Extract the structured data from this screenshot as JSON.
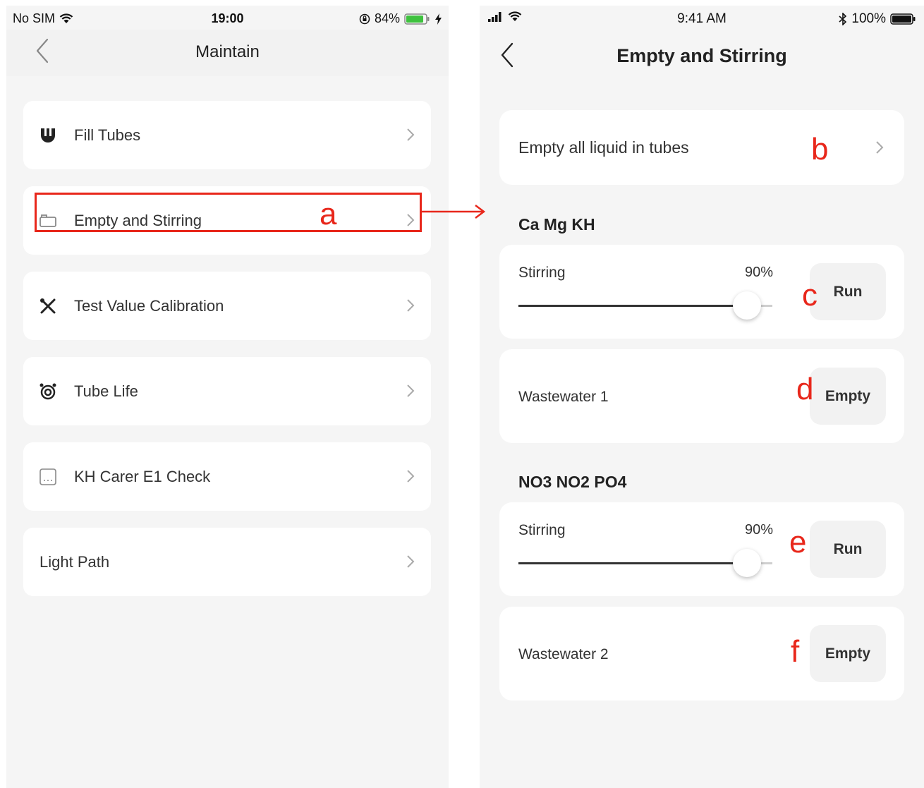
{
  "left_screen": {
    "status_bar": {
      "carrier": "No SIM",
      "time": "19:00",
      "battery": "84%"
    },
    "title": "Maintain",
    "menu": [
      {
        "label": "Fill Tubes",
        "icon": "fill-tubes-icon"
      },
      {
        "label": "Empty and Stirring",
        "icon": "tank-icon"
      },
      {
        "label": "Test Value Calibration",
        "icon": "tools-icon"
      },
      {
        "label": "Tube Life",
        "icon": "tube-life-icon"
      },
      {
        "label": "KH Carer E1 Check",
        "icon": "message-icon"
      },
      {
        "label": "Light Path",
        "icon": ""
      }
    ]
  },
  "right_screen": {
    "status_bar": {
      "time": "9:41 AM",
      "battery": "100%"
    },
    "title": "Empty and Stirring",
    "empty_all": {
      "label": "Empty all liquid in tubes"
    },
    "sections": [
      {
        "title": "Ca Mg KH",
        "stirring": {
          "label": "Stirring",
          "value_text": "90%",
          "value": 0.9,
          "button": "Run"
        },
        "wastewater": {
          "label": "Wastewater 1",
          "button": "Empty"
        }
      },
      {
        "title": "NO3 NO2 PO4",
        "stirring": {
          "label": "Stirring",
          "value_text": "90%",
          "value": 0.9,
          "button": "Run"
        },
        "wastewater": {
          "label": "Wastewater 2",
          "button": "Empty"
        }
      }
    ]
  },
  "annotations": {
    "a": "a",
    "b": "b",
    "c": "c",
    "d": "d",
    "e": "e",
    "f": "f"
  },
  "colors": {
    "annotation": "#e8271b",
    "background": "#f5f5f5",
    "card": "#ffffff"
  }
}
